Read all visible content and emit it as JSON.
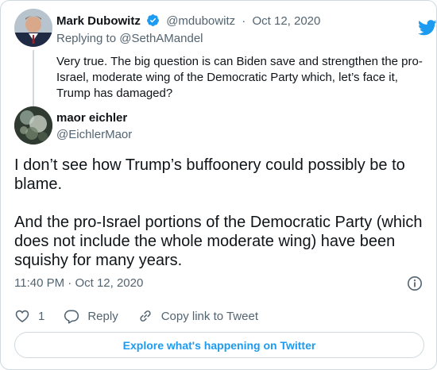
{
  "parent_tweet": {
    "author_name": "Mark Dubowitz",
    "handle": "@mdubowitz",
    "separator": "·",
    "date": "Oct 12, 2020",
    "reply_prefix": "Replying to",
    "reply_handle": "@SethAMandel",
    "text": "Very true. The big question is can Biden save and strengthen the pro-Israel, moderate wing of the Democratic Party which, let’s face it, Trump has damaged?"
  },
  "main_tweet": {
    "author_name": "maor eichler",
    "handle": "@EichlerMaor",
    "text": "I don’t see how Trump’s buffoonery could possibly be to blame.\n\nAnd the pro-Israel portions of the Democratic Party (which does not include the whole moderate wing) have been squishy for many years.",
    "time": "11:40 PM",
    "separator": "·",
    "date": "Oct 12, 2020"
  },
  "actions": {
    "like_count": "1",
    "reply_label": "Reply",
    "copy_link_label": "Copy link to Tweet"
  },
  "explore_label": "Explore what's happening on Twitter",
  "icons": {
    "brand": "twitter-bird-icon",
    "verified": "verified-badge-icon",
    "info": "info-icon",
    "like": "heart-icon",
    "reply": "reply-bubble-icon",
    "link": "link-icon"
  },
  "colors": {
    "brand_blue": "#1d9bf0",
    "text": "#0f1419",
    "secondary_text": "#536471",
    "border": "#cfd9de"
  }
}
